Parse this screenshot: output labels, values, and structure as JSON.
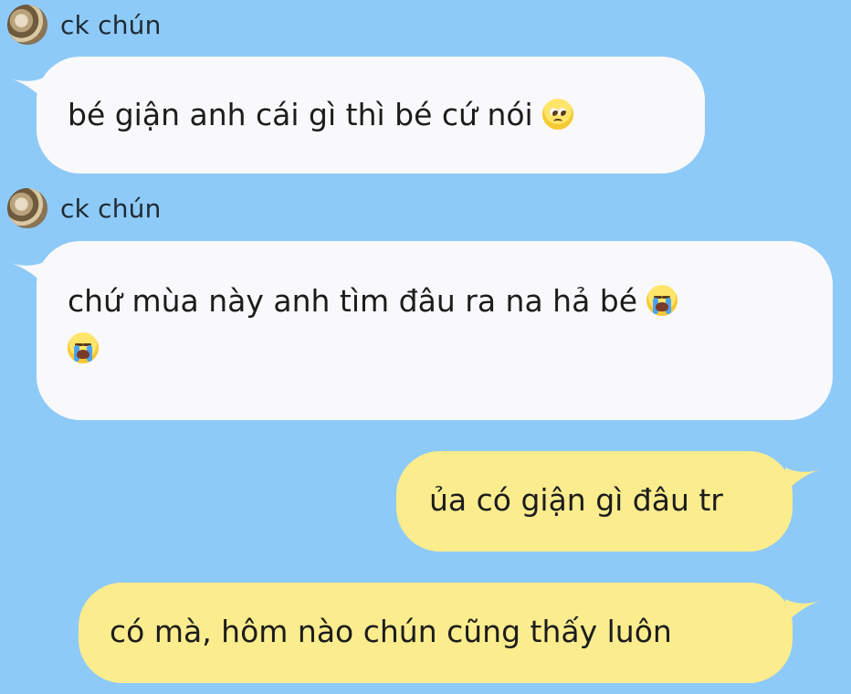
{
  "chat": {
    "background_color": "#8ecaf7",
    "incoming_bubble_color": "#f9f9fb",
    "outgoing_bubble_color": "#fbec8e",
    "messages": [
      {
        "direction": "incoming",
        "sender": "ck chún",
        "text": "bé giận anh cái gì thì bé cứ nói",
        "emoji": [
          "pleading-face-emoji"
        ]
      },
      {
        "direction": "incoming",
        "sender": "ck chún",
        "text": "chứ mùa này anh tìm đâu ra na hả bé",
        "emoji": [
          "loudly-crying-face-emoji",
          "loudly-crying-face-emoji"
        ]
      },
      {
        "direction": "outgoing",
        "text": "ủa có giận gì đâu tr"
      },
      {
        "direction": "outgoing",
        "text": "có mà, hôm nào chún cũng thấy luôn"
      }
    ]
  }
}
